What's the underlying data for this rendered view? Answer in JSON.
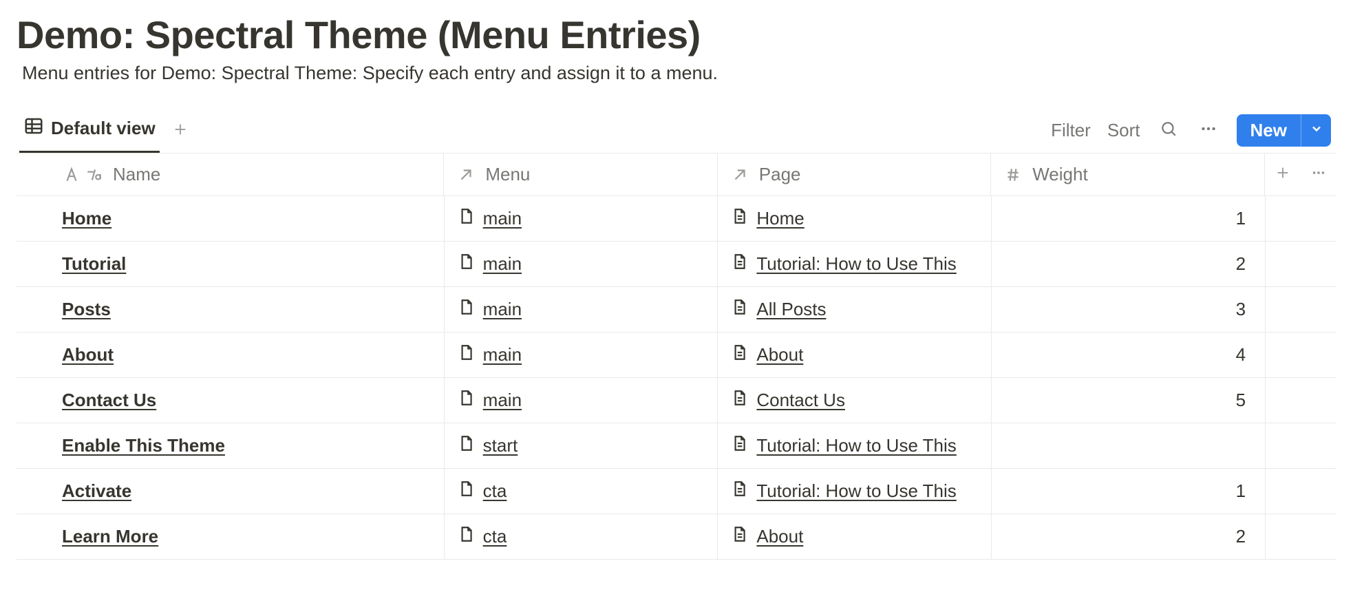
{
  "page": {
    "title": "Demo: Spectral Theme (Menu Entries)",
    "subtitle": "Menu entries for Demo: Spectral Theme: Specify each entry and assign it to a menu."
  },
  "views": {
    "active": "Default view"
  },
  "toolbar": {
    "filter": "Filter",
    "sort": "Sort",
    "new": "New"
  },
  "columns": {
    "name": "Name",
    "menu": "Menu",
    "page": "Page",
    "weight": "Weight"
  },
  "rows": [
    {
      "name": "Home",
      "menu": "main",
      "page": "Home",
      "weight": "1"
    },
    {
      "name": "Tutorial",
      "menu": "main",
      "page": "Tutorial: How to Use This",
      "weight": "2"
    },
    {
      "name": "Posts",
      "menu": "main",
      "page": "All Posts",
      "weight": "3"
    },
    {
      "name": "About",
      "menu": "main",
      "page": "About",
      "weight": "4"
    },
    {
      "name": "Contact Us",
      "menu": "main",
      "page": "Contact Us",
      "weight": "5"
    },
    {
      "name": "Enable This Theme",
      "menu": "start",
      "page": "Tutorial: How to Use This",
      "weight": ""
    },
    {
      "name": "Activate",
      "menu": "cta",
      "page": "Tutorial: How to Use This",
      "weight": "1"
    },
    {
      "name": "Learn More",
      "menu": "cta",
      "page": "About",
      "weight": "2"
    }
  ]
}
